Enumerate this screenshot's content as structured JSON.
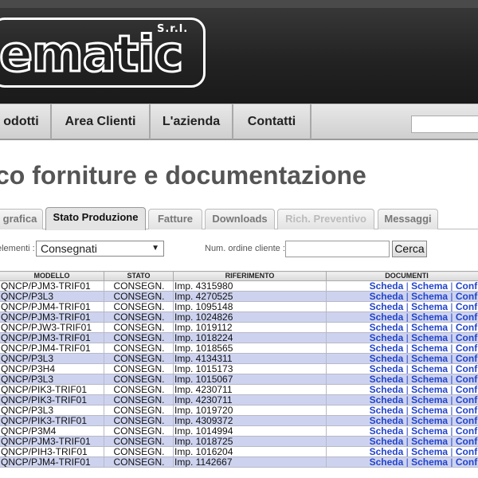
{
  "header": {
    "logo_text": "ematic",
    "logo_suffix": "S.r.l."
  },
  "nav": {
    "items": [
      "odotti",
      "Area Clienti",
      "L'azienda",
      "Contatti"
    ]
  },
  "page": {
    "title": "co forniture e documentazione"
  },
  "tabs": [
    {
      "label": "grafica",
      "state": "normal"
    },
    {
      "label": "Stato Produzione",
      "state": "active"
    },
    {
      "label": "Fatture",
      "state": "normal"
    },
    {
      "label": "Downloads",
      "state": "normal"
    },
    {
      "label": "Rich. Preventivo",
      "state": "disabled"
    },
    {
      "label": "Messaggi",
      "state": "normal"
    }
  ],
  "filter": {
    "elements_label": "elementi :",
    "selected": "Consegnati",
    "order_label": "Num. ordine cliente :",
    "order_value": "",
    "search_label": "Cerca"
  },
  "table": {
    "headers": [
      "MODELLO",
      "STATO",
      "RIFERIMENTO",
      "DOCUMENTI"
    ],
    "doc_links": [
      "Scheda",
      "Schema",
      "Conf."
    ],
    "rows": [
      {
        "modello": "QNCP/PJM3-TRIF01",
        "stato": "CONSEGN.",
        "riferimento": "Imp. 4315980"
      },
      {
        "modello": "QNCP/P3L3",
        "stato": "CONSEGN.",
        "riferimento": "Imp. 4270525"
      },
      {
        "modello": "QNCP/PJM4-TRIF01",
        "stato": "CONSEGN.",
        "riferimento": "Imp. 1095148"
      },
      {
        "modello": "QNCP/PJM3-TRIF01",
        "stato": "CONSEGN.",
        "riferimento": "Imp. 1024826"
      },
      {
        "modello": "QNCP/PJW3-TRIF01",
        "stato": "CONSEGN.",
        "riferimento": "Imp. 1019112"
      },
      {
        "modello": "QNCP/PJM3-TRIF01",
        "stato": "CONSEGN.",
        "riferimento": "Imp. 1018224"
      },
      {
        "modello": "QNCP/PJM4-TRIF01",
        "stato": "CONSEGN.",
        "riferimento": "Imp. 1018565"
      },
      {
        "modello": "QNCP/P3L3",
        "stato": "CONSEGN.",
        "riferimento": "Imp. 4134311"
      },
      {
        "modello": "QNCP/P3H4",
        "stato": "CONSEGN.",
        "riferimento": "Imp. 1015173"
      },
      {
        "modello": "QNCP/P3L3",
        "stato": "CONSEGN.",
        "riferimento": "Imp. 1015067"
      },
      {
        "modello": "QNCP/PIK3-TRIF01",
        "stato": "CONSEGN.",
        "riferimento": "Imp. 4230711"
      },
      {
        "modello": "QNCP/PIK3-TRIF01",
        "stato": "CONSEGN.",
        "riferimento": "Imp. 4230711"
      },
      {
        "modello": "QNCP/P3L3",
        "stato": "CONSEGN.",
        "riferimento": "Imp. 1019720"
      },
      {
        "modello": "QNCP/PIK3-TRIF01",
        "stato": "CONSEGN.",
        "riferimento": "Imp. 4309372"
      },
      {
        "modello": "QNCP/P3M4",
        "stato": "CONSEGN.",
        "riferimento": "Imp. 1014994"
      },
      {
        "modello": "QNCP/PJM3-TRIF01",
        "stato": "CONSEGN.",
        "riferimento": "Imp. 1018725"
      },
      {
        "modello": "QNCP/PIH3-TRIF01",
        "stato": "CONSEGN.",
        "riferimento": "Imp. 1016204"
      },
      {
        "modello": "QNCP/PJM4-TRIF01",
        "stato": "CONSEGN.",
        "riferimento": "Imp. 1142667"
      }
    ]
  },
  "colors": {
    "link": "#2244cc",
    "row_alt": "#cdd3ef"
  }
}
